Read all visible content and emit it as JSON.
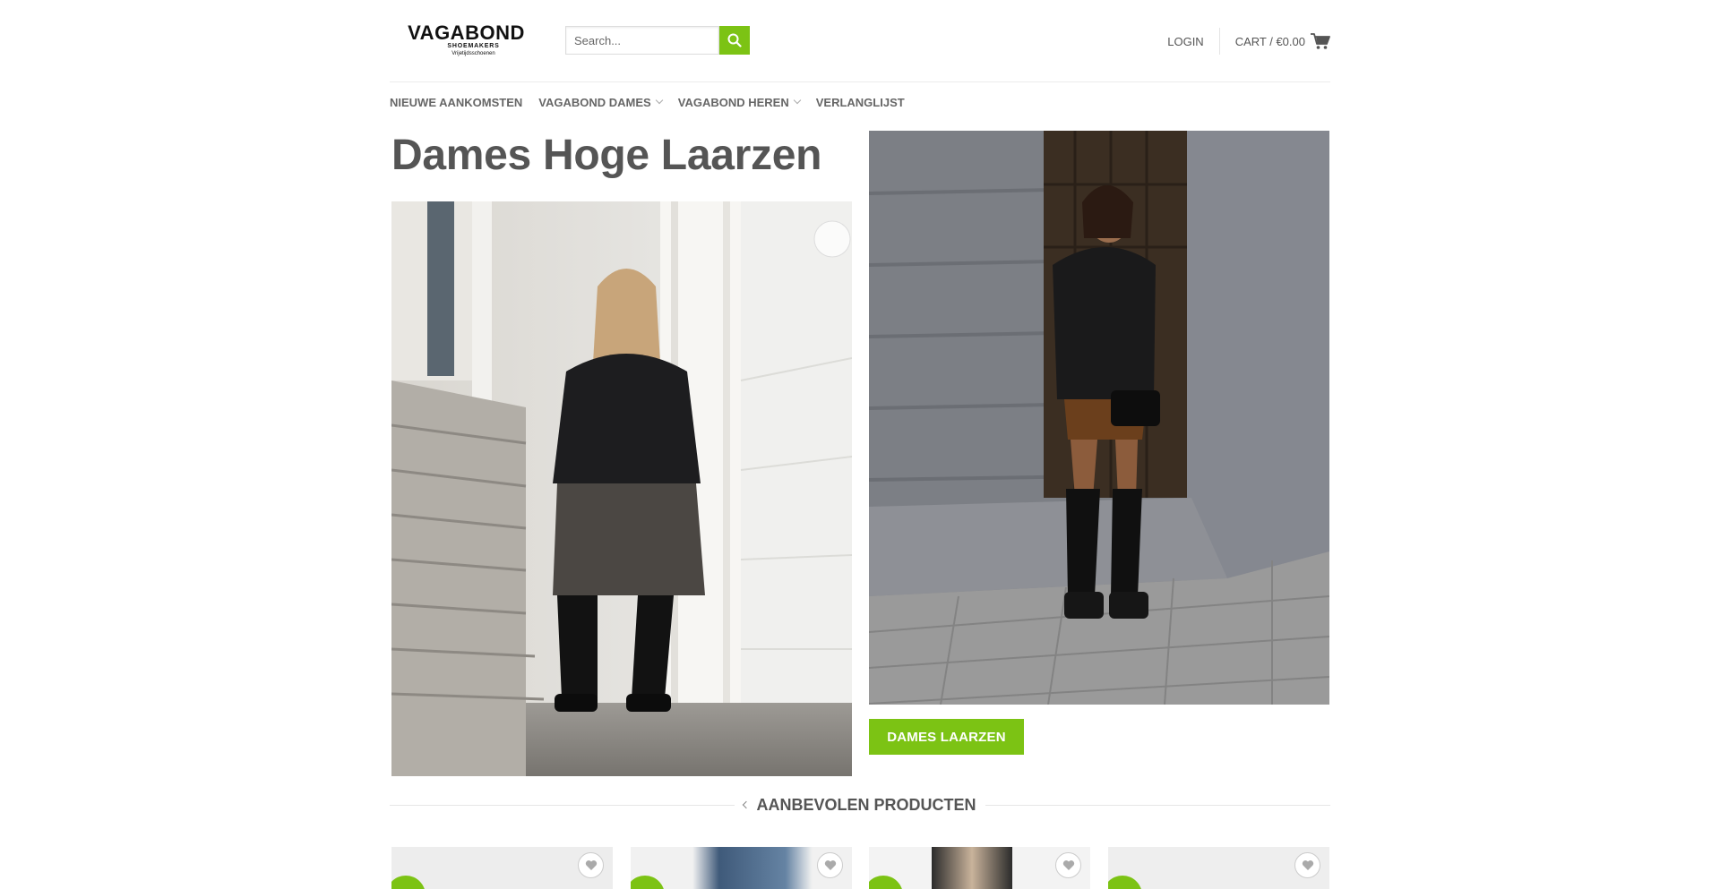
{
  "header": {
    "logo": {
      "main": "VAGABOND",
      "sub": "SHOEMAKERS",
      "tagline": "Vrijetijdsschoenen"
    },
    "search": {
      "placeholder": "Search...",
      "button_icon": "search-icon"
    },
    "login_label": "LOGIN",
    "cart_label": "CART / €0.00",
    "cart_icon": "cart-icon"
  },
  "nav": {
    "items": [
      {
        "label": "NIEUWE AANKOMSTEN",
        "has_dropdown": false
      },
      {
        "label": "VAGABOND DAMES",
        "has_dropdown": true
      },
      {
        "label": "VAGABOND HEREN",
        "has_dropdown": true
      },
      {
        "label": "VERLANGLIJST",
        "has_dropdown": false
      }
    ]
  },
  "hero": {
    "title": "Dames Hoge Laarzen",
    "cta_label": "DAMES LAARZEN"
  },
  "recommended": {
    "title": "AANBEVOLEN PRODUCTEN",
    "products": [
      {
        "wishlist_icon": "heart-icon"
      },
      {
        "wishlist_icon": "heart-icon"
      },
      {
        "wishlist_icon": "heart-icon"
      },
      {
        "wishlist_icon": "heart-icon"
      }
    ]
  },
  "colors": {
    "accent": "#7cc314",
    "text": "#555555"
  }
}
